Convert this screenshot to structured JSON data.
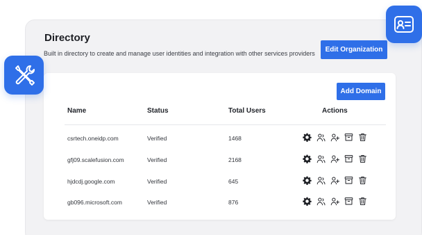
{
  "directory": {
    "title": "Directory",
    "subtitle": "Built in directory to create and manage user identities and integration with other services providers",
    "edit_label": "Edit Organization",
    "add_label": "Add Domain"
  },
  "table": {
    "columns": [
      "Name",
      "Status",
      "Total Users",
      "Actions"
    ],
    "rows": [
      {
        "domain": "csrtech.oneidp.com",
        "status": "Verified",
        "users": "1468"
      },
      {
        "domain": "gfj09.scalefusion.com",
        "status": "Verified",
        "users": "2168"
      },
      {
        "domain": "hjdcdj.google.com",
        "status": "Verified",
        "users": "645"
      },
      {
        "domain": "gb096.microsoft.com",
        "status": "Verified",
        "users": "876"
      }
    ],
    "action_icons": [
      "gear-icon",
      "users-link-icon",
      "user-add-icon",
      "archive-icon",
      "trash-icon"
    ]
  },
  "decor_icons": [
    "tools-icon",
    "id-card-icon"
  ],
  "colors": {
    "accent": "#2f6fe8",
    "panel_bg": "#f2f2f4",
    "text": "#1d1f24"
  }
}
